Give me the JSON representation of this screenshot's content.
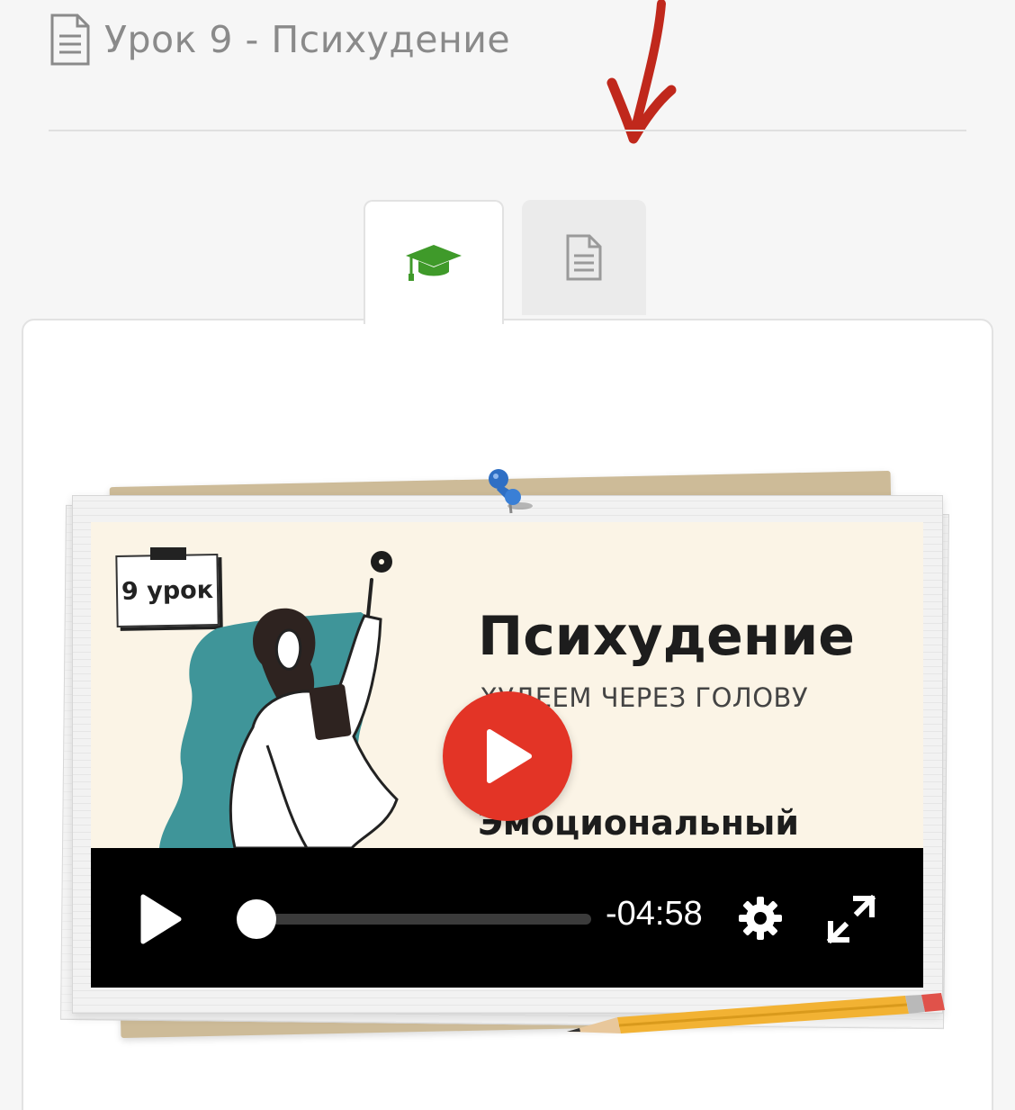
{
  "lesson": {
    "title": "Урок 9 - Психудение",
    "title_icon": "document-icon"
  },
  "tabs": [
    {
      "id": "lesson",
      "icon": "graduation-cap-icon",
      "active": true,
      "color": "#3f9a2a"
    },
    {
      "id": "text",
      "icon": "document-icon",
      "active": false
    }
  ],
  "video": {
    "thumbnail": {
      "badge": "9 урок",
      "title": "Психудение",
      "subtitle": "ХУДЕЕМ ЧЕРЕЗ ГОЛОВУ",
      "subtitle2": "Эмоциональный",
      "accent_color": "#3f9599"
    },
    "play_button_color": "#e33426",
    "controls": {
      "time_remaining": "-04:58",
      "progress": 0
    }
  },
  "colors": {
    "background": "#f6f6f6",
    "arrow": "#c0281c"
  }
}
